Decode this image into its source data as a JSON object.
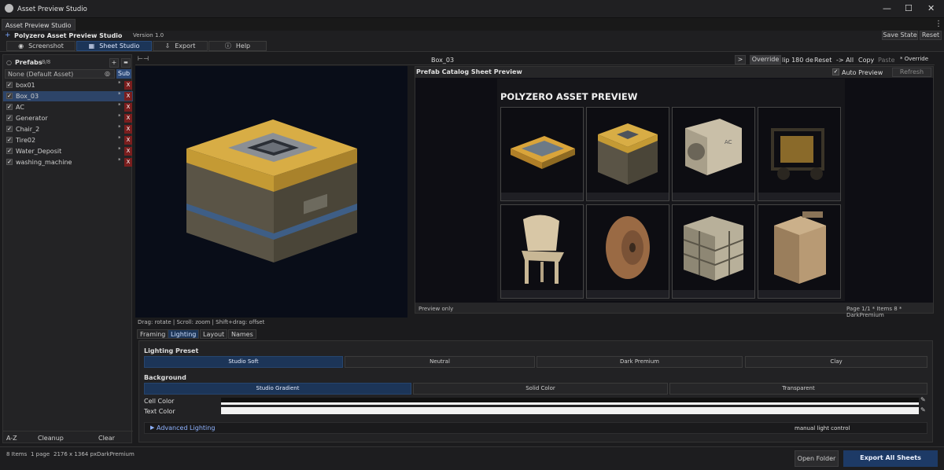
{
  "window": {
    "title": "Asset Preview Studio",
    "controls": [
      "—",
      "☐",
      "✕"
    ]
  },
  "doc_tab": "Asset Preview Studio",
  "menu": {
    "plus": "+",
    "app_name": "Polyzero  Asset Preview Studio",
    "version": "Version 1.0",
    "save_state": "Save State",
    "reset": "Reset"
  },
  "tabs": [
    {
      "label": "Screenshot",
      "icon": "camera-icon"
    },
    {
      "label": "Sheet Studio",
      "icon": "grid-icon"
    },
    {
      "label": "Export",
      "icon": "export-icon"
    },
    {
      "label": "Help",
      "icon": "help-icon"
    }
  ],
  "prefabs": {
    "title": "Prefabs",
    "count": "8/8",
    "add": "+",
    "folder": "▬",
    "none_field": "None (Default Asset)",
    "sub": "Sub",
    "items": [
      {
        "name": "box01",
        "checked": true,
        "selected": false
      },
      {
        "name": "Box_03",
        "checked": true,
        "selected": true
      },
      {
        "name": "AC",
        "checked": true,
        "selected": false
      },
      {
        "name": "Generator",
        "checked": true,
        "selected": false
      },
      {
        "name": "Chair_2",
        "checked": true,
        "selected": false
      },
      {
        "name": "Tire02",
        "checked": true,
        "selected": false
      },
      {
        "name": "Water_Deposit",
        "checked": true,
        "selected": false
      },
      {
        "name": "washing_machine",
        "checked": true,
        "selected": false
      }
    ],
    "remove_label": "X",
    "star": "*",
    "footer": {
      "az": "A-Z",
      "cleanup": "Cleanup",
      "clear": "Clear"
    }
  },
  "viewer": {
    "asset_name": "Box_03",
    "next": ">",
    "override": "Override",
    "flip": "lip 180 de",
    "reset": "Reset",
    "all": "-> All",
    "copy": "Copy",
    "paste": "Paste",
    "override_flag": "* Override",
    "hint": "Drag: rotate  |  Scroll: zoom  |  Shift+drag: offset"
  },
  "preview": {
    "title": "Prefab Catalog Sheet Preview",
    "auto": "Auto Preview",
    "refresh": "Refresh",
    "sheet_title": "POLYZERO ASSET PREVIEW",
    "left_status": "Preview only",
    "right_status": "Page 1/1 * Items 8 * DarkPremium"
  },
  "subtabs": [
    {
      "label": "Framing",
      "active": false
    },
    {
      "label": "Lighting",
      "active": true
    },
    {
      "label": "Layout",
      "active": false
    },
    {
      "label": "Names",
      "active": false
    }
  ],
  "lighting": {
    "preset_title": "Lighting Preset",
    "presets": [
      {
        "label": "Studio Soft",
        "active": true
      },
      {
        "label": "Neutral",
        "active": false
      },
      {
        "label": "Dark Premium",
        "active": false
      },
      {
        "label": "Clay",
        "active": false
      }
    ],
    "bg_title": "Background",
    "bgs": [
      {
        "label": "Studio Gradient",
        "active": true
      },
      {
        "label": "Solid Color",
        "active": false
      },
      {
        "label": "Transparent",
        "active": false
      }
    ],
    "cell_color_label": "Cell Color",
    "text_color_label": "Text Color",
    "cell_color": "#f2f2f2",
    "text_color": "#f2f2f2",
    "advanced": "Advanced Lighting",
    "advanced_note": "manual light control"
  },
  "status": {
    "items": "8 Items",
    "pages": "1 page",
    "size": "2176 x 1364 px",
    "theme": "DarkPremium",
    "open_folder": "Open Folder",
    "export_all": "Export All Sheets"
  },
  "colors": {
    "accent": "#1c3558",
    "panel": "#232325",
    "sheet_bg": "#16161a"
  }
}
